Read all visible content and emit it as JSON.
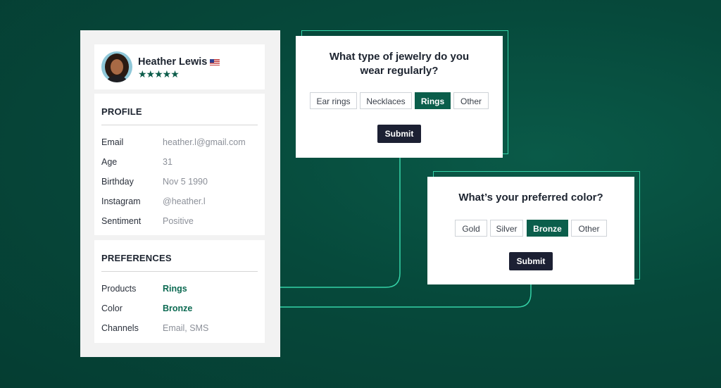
{
  "colors": {
    "background": "#06493b",
    "accent": "#35d3a8",
    "brand_dark": "#0b5e4b",
    "submit": "#1c2033"
  },
  "profile": {
    "name": "Heather Lewis",
    "flag_icon": "us-flag-icon",
    "rating_stars": "★★★★★",
    "rating": 5,
    "section_title": "PROFILE",
    "fields": [
      {
        "label": "Email",
        "value": "heather.l@gmail.com"
      },
      {
        "label": "Age",
        "value": "31"
      },
      {
        "label": "Birthday",
        "value": "Nov 5 1990"
      },
      {
        "label": "Instagram",
        "value": "@heather.l"
      },
      {
        "label": "Sentiment",
        "value": "Positive"
      }
    ]
  },
  "preferences": {
    "section_title": "PREFERENCES",
    "fields": [
      {
        "label": "Products",
        "value": "Rings"
      },
      {
        "label": "Color",
        "value": "Bronze"
      },
      {
        "label": "Channels",
        "value": "Email, SMS"
      }
    ]
  },
  "question1": {
    "title_line1": "What type of jewelry do you",
    "title_line2": "wear regularly?",
    "options": [
      "Ear rings",
      "Necklaces",
      "Rings",
      "Other"
    ],
    "selected": "Rings",
    "submit_label": "Submit"
  },
  "question2": {
    "title": "What’s your preferred color?",
    "options": [
      "Gold",
      "Silver",
      "Bronze",
      "Other"
    ],
    "selected": "Bronze",
    "submit_label": "Submit"
  }
}
